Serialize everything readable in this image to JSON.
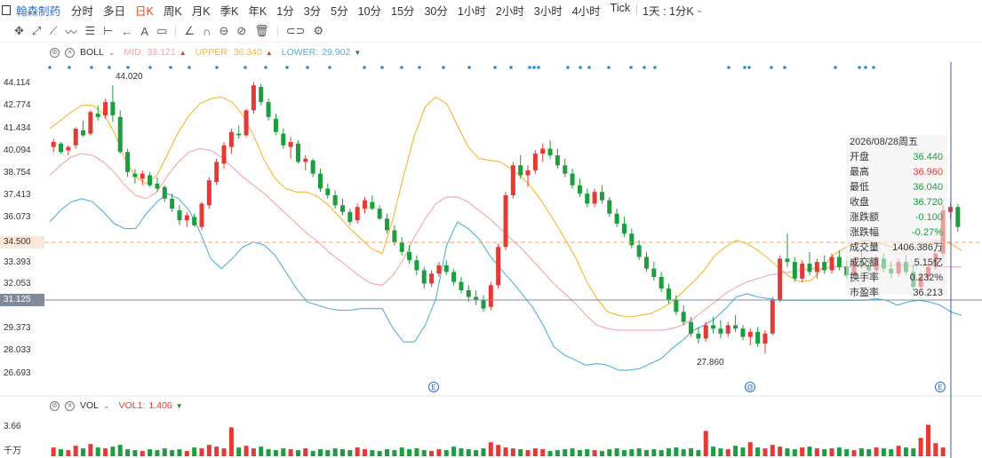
{
  "header": {
    "stock_name": "翰森制药",
    "periods": [
      "分时",
      "多日",
      "日K",
      "周K",
      "月K",
      "季K",
      "年K",
      "1分",
      "3分",
      "5分",
      "10分",
      "15分",
      "30分",
      "1小时",
      "2小时",
      "3小时",
      "4小时",
      "Tick"
    ],
    "active_period": "日K",
    "period_select": "1天 : 1分K"
  },
  "boll": {
    "name": "BOLL",
    "mid_label": "MID:",
    "mid": "33.121",
    "upper_label": "UPPER:",
    "upper": "36.340",
    "lower_label": "LOWER:",
    "lower": "29.902"
  },
  "vol": {
    "name": "VOL",
    "vol1_label": "VOL1:",
    "vol1": "1.406"
  },
  "y_axis": [
    "44.114",
    "42.774",
    "41.434",
    "40.094",
    "38.754",
    "37.413",
    "36.073",
    "33.393",
    "32.053",
    "29.373",
    "28.033",
    "26.693"
  ],
  "price_tags": {
    "last": "34.500",
    "cross": "31.125"
  },
  "annotations": {
    "high": "44.020",
    "low": "27.860"
  },
  "vol_axis": {
    "top": "3.66",
    "unit": "千万"
  },
  "event_markers": [
    "E",
    "@",
    "E"
  ],
  "tooltip": [
    {
      "label": "2026/08/28周五",
      "value": "",
      "color": ""
    },
    {
      "label": "开盘",
      "value": "36.440",
      "color": "green"
    },
    {
      "label": "最高",
      "value": "36.960",
      "color": "red"
    },
    {
      "label": "最低",
      "value": "36.040",
      "color": "green"
    },
    {
      "label": "收盘",
      "value": "36.720",
      "color": "green"
    },
    {
      "label": "涨跌额",
      "value": "-0.100",
      "color": "green"
    },
    {
      "label": "涨跌幅",
      "value": "-0.27%",
      "color": "green"
    },
    {
      "label": "成交量",
      "value": "1406.386万",
      "color": ""
    },
    {
      "label": "成交额",
      "value": "5.15亿",
      "color": ""
    },
    {
      "label": "换手率",
      "value": "0.232%",
      "color": ""
    },
    {
      "label": "市盈率",
      "value": "36.213",
      "color": ""
    }
  ],
  "colors": {
    "up": "#e53935",
    "down": "#1b9e3e",
    "upper": "#f5b82e",
    "mid": "#f4a6a8",
    "lower": "#4fb3d9",
    "accent": "#2a6ed6"
  },
  "chart_data": {
    "type": "candlestick",
    "ylim": [
      26.0,
      45.5
    ],
    "candles": [
      [
        40.3,
        40.8,
        40.0,
        40.6
      ],
      [
        40.5,
        40.6,
        39.9,
        40.0
      ],
      [
        40.1,
        40.4,
        39.8,
        40.3
      ],
      [
        40.4,
        41.5,
        40.2,
        41.4
      ],
      [
        41.3,
        41.9,
        40.9,
        41.0
      ],
      [
        41.1,
        42.5,
        41.0,
        42.4
      ],
      [
        42.3,
        42.8,
        41.9,
        42.1
      ],
      [
        42.2,
        43.2,
        42.0,
        43.0
      ],
      [
        43.0,
        44.0,
        41.8,
        42.2
      ],
      [
        42.1,
        42.5,
        39.9,
        40.0
      ],
      [
        40.0,
        40.2,
        38.5,
        38.8
      ],
      [
        38.7,
        39.0,
        38.1,
        38.5
      ],
      [
        38.4,
        38.9,
        38.0,
        38.7
      ],
      [
        38.6,
        38.8,
        37.9,
        38.0
      ],
      [
        38.1,
        38.5,
        37.6,
        37.8
      ],
      [
        37.9,
        38.0,
        37.0,
        37.2
      ],
      [
        37.2,
        37.5,
        36.4,
        36.6
      ],
      [
        36.5,
        36.8,
        35.6,
        35.9
      ],
      [
        35.9,
        36.4,
        35.5,
        36.2
      ],
      [
        36.1,
        36.3,
        35.5,
        35.6
      ],
      [
        35.5,
        37.0,
        35.3,
        36.9
      ],
      [
        36.8,
        38.5,
        36.6,
        38.3
      ],
      [
        38.2,
        39.6,
        38.0,
        39.4
      ],
      [
        39.3,
        40.6,
        39.0,
        40.4
      ],
      [
        40.3,
        41.4,
        39.9,
        41.2
      ],
      [
        41.1,
        41.6,
        40.8,
        41.0
      ],
      [
        41.0,
        42.6,
        40.9,
        42.5
      ],
      [
        42.5,
        44.2,
        42.3,
        44.0
      ],
      [
        43.9,
        44.1,
        42.8,
        43.0
      ],
      [
        43.0,
        43.2,
        41.9,
        42.1
      ],
      [
        42.0,
        42.3,
        41.0,
        41.2
      ],
      [
        41.1,
        41.4,
        40.2,
        40.4
      ],
      [
        40.3,
        40.9,
        39.6,
        40.6
      ],
      [
        40.5,
        40.7,
        39.3,
        39.4
      ],
      [
        39.4,
        39.8,
        38.9,
        39.6
      ],
      [
        39.5,
        39.6,
        38.5,
        38.7
      ],
      [
        38.7,
        39.0,
        37.6,
        37.8
      ],
      [
        37.8,
        38.1,
        37.2,
        37.4
      ],
      [
        37.4,
        37.7,
        36.6,
        36.8
      ],
      [
        36.8,
        37.2,
        36.2,
        36.4
      ],
      [
        36.4,
        36.6,
        35.6,
        35.8
      ],
      [
        35.9,
        36.9,
        35.7,
        36.7
      ],
      [
        36.6,
        37.3,
        36.3,
        37.1
      ],
      [
        37.0,
        37.4,
        36.5,
        36.6
      ],
      [
        36.6,
        36.8,
        35.9,
        36.0
      ],
      [
        36.0,
        36.3,
        35.1,
        35.3
      ],
      [
        35.3,
        35.6,
        34.4,
        34.6
      ],
      [
        34.6,
        34.9,
        33.8,
        34.0
      ],
      [
        34.0,
        34.4,
        33.3,
        33.5
      ],
      [
        33.5,
        33.8,
        32.6,
        32.9
      ],
      [
        32.9,
        33.1,
        31.8,
        32.1
      ],
      [
        32.1,
        32.9,
        31.9,
        32.7
      ],
      [
        32.7,
        33.4,
        32.5,
        33.2
      ],
      [
        33.2,
        33.5,
        32.6,
        32.8
      ],
      [
        32.8,
        33.0,
        32.0,
        32.2
      ],
      [
        32.2,
        32.5,
        31.5,
        31.7
      ],
      [
        31.7,
        32.0,
        31.0,
        31.3
      ],
      [
        31.3,
        31.7,
        30.8,
        31.1
      ],
      [
        31.1,
        31.4,
        30.4,
        30.6
      ],
      [
        30.7,
        32.2,
        30.5,
        32.0
      ],
      [
        32.0,
        34.5,
        31.8,
        34.3
      ],
      [
        34.3,
        37.6,
        34.1,
        37.4
      ],
      [
        37.4,
        39.4,
        37.2,
        39.2
      ],
      [
        39.2,
        39.8,
        38.4,
        38.6
      ],
      [
        38.6,
        39.2,
        37.9,
        38.9
      ],
      [
        38.9,
        40.1,
        38.7,
        39.9
      ],
      [
        39.9,
        40.5,
        39.4,
        40.2
      ],
      [
        40.2,
        40.7,
        39.6,
        39.8
      ],
      [
        39.8,
        40.2,
        39.0,
        39.2
      ],
      [
        39.2,
        39.6,
        38.5,
        38.7
      ],
      [
        38.7,
        39.0,
        37.8,
        38.0
      ],
      [
        38.0,
        38.4,
        37.3,
        37.5
      ],
      [
        37.5,
        37.8,
        36.7,
        36.9
      ],
      [
        36.9,
        37.8,
        36.7,
        37.6
      ],
      [
        37.6,
        38.0,
        36.9,
        37.1
      ],
      [
        37.1,
        37.3,
        36.1,
        36.3
      ],
      [
        36.3,
        36.6,
        35.5,
        35.7
      ],
      [
        35.7,
        36.1,
        34.9,
        35.1
      ],
      [
        35.1,
        35.4,
        34.2,
        34.4
      ],
      [
        34.4,
        34.7,
        33.5,
        33.7
      ],
      [
        33.7,
        34.0,
        32.8,
        33.0
      ],
      [
        33.0,
        33.4,
        32.3,
        32.5
      ],
      [
        32.5,
        32.8,
        31.6,
        31.8
      ],
      [
        31.8,
        32.1,
        30.9,
        31.1
      ],
      [
        31.1,
        31.4,
        30.2,
        30.4
      ],
      [
        30.4,
        30.8,
        29.6,
        29.8
      ],
      [
        29.8,
        30.1,
        28.9,
        29.1
      ],
      [
        29.1,
        29.5,
        28.5,
        28.8
      ],
      [
        28.8,
        29.8,
        28.6,
        29.6
      ],
      [
        29.6,
        30.1,
        29.1,
        29.4
      ],
      [
        29.4,
        29.9,
        28.8,
        29.1
      ],
      [
        29.1,
        29.8,
        28.9,
        29.6
      ],
      [
        29.6,
        30.2,
        29.2,
        29.4
      ],
      [
        29.4,
        29.6,
        28.7,
        28.9
      ],
      [
        28.9,
        29.4,
        28.4,
        29.2
      ],
      [
        29.2,
        29.5,
        28.3,
        28.5
      ],
      [
        28.5,
        29.3,
        27.9,
        29.1
      ],
      [
        29.1,
        31.3,
        29.0,
        31.1
      ],
      [
        31.1,
        33.8,
        31.0,
        33.6
      ],
      [
        33.6,
        35.1,
        33.1,
        33.4
      ],
      [
        33.4,
        33.7,
        32.2,
        32.4
      ],
      [
        32.4,
        33.5,
        32.2,
        33.3
      ],
      [
        33.3,
        34.0,
        32.6,
        32.8
      ],
      [
        32.8,
        33.6,
        32.4,
        33.4
      ],
      [
        33.4,
        33.8,
        32.7,
        32.9
      ],
      [
        32.9,
        33.9,
        32.7,
        33.7
      ],
      [
        33.7,
        34.1,
        32.9,
        33.1
      ],
      [
        33.1,
        33.5,
        32.4,
        32.6
      ],
      [
        32.6,
        33.7,
        32.5,
        33.5
      ],
      [
        33.5,
        34.2,
        33.0,
        33.2
      ],
      [
        33.2,
        33.6,
        32.6,
        32.9
      ],
      [
        32.9,
        33.8,
        32.7,
        33.6
      ],
      [
        33.6,
        33.9,
        32.8,
        33.0
      ],
      [
        33.0,
        33.4,
        32.4,
        32.7
      ],
      [
        32.7,
        33.6,
        32.5,
        33.4
      ],
      [
        33.4,
        33.8,
        32.6,
        32.8
      ],
      [
        32.8,
        33.2,
        31.7,
        31.9
      ],
      [
        31.9,
        32.7,
        31.7,
        32.5
      ],
      [
        32.5,
        33.3,
        32.3,
        33.1
      ],
      [
        33.1,
        34.1,
        32.9,
        33.9
      ],
      [
        33.9,
        36.8,
        33.7,
        36.5
      ],
      [
        36.4,
        36.9,
        36.0,
        36.7
      ],
      [
        36.7,
        36.9,
        35.2,
        35.5
      ]
    ],
    "volumes": [
      1.0,
      0.8,
      0.7,
      1.2,
      0.9,
      1.4,
      1.0,
      0.9,
      1.1,
      1.3,
      0.8,
      0.7,
      0.6,
      0.8,
      0.7,
      0.9,
      0.7,
      0.8,
      0.6,
      1.0,
      0.9,
      1.3,
      1.1,
      0.9,
      3.3,
      1.0,
      1.2,
      0.9,
      1.1,
      0.8,
      0.7,
      0.9,
      0.8,
      0.7,
      0.9,
      0.6,
      0.8,
      0.7,
      0.9,
      0.8,
      0.7,
      1.0,
      0.8,
      0.7,
      0.6,
      0.8,
      0.7,
      1.0,
      0.8,
      0.9,
      0.7,
      0.6,
      0.8,
      0.7,
      1.1,
      0.9,
      0.8,
      0.7,
      0.9,
      1.6,
      1.3,
      1.0,
      0.9,
      0.8,
      0.7,
      0.9,
      0.8,
      0.6,
      0.7,
      0.8,
      0.9,
      0.7,
      0.8,
      0.7,
      0.6,
      0.8,
      0.9,
      0.7,
      0.8,
      0.9,
      0.7,
      0.8,
      0.7,
      0.9,
      1.0,
      0.8,
      0.9,
      0.7,
      2.9,
      1.1,
      0.9,
      0.8,
      1.2,
      1.0,
      1.6,
      1.0,
      0.9,
      1.3,
      1.1,
      0.9,
      0.8,
      1.0,
      1.1,
      0.9,
      0.8,
      0.9,
      1.0,
      0.8,
      0.7,
      0.9,
      0.8,
      1.0,
      0.9,
      0.8,
      1.2,
      1.0,
      0.9,
      2.1,
      3.6,
      1.5,
      1.0
    ],
    "upper": [
      41.4,
      41.9,
      42.4,
      42.8,
      42.8,
      42.3,
      41.2,
      39.6,
      38.5,
      38.1,
      38.6,
      39.9,
      41.2,
      42.2,
      42.9,
      43.2,
      43.3,
      43.0,
      42.2,
      41.0,
      39.5,
      38.4,
      37.8,
      37.6,
      37.6,
      37.3,
      36.8,
      36.1,
      35.4,
      34.8,
      34.2,
      33.9,
      36.0,
      38.6,
      41.0,
      42.7,
      43.3,
      42.9,
      41.6,
      40.3,
      39.6,
      39.5,
      39.4,
      39.0,
      38.5,
      37.8,
      36.9,
      35.9,
      34.8,
      33.7,
      32.3,
      31.2,
      30.4,
      30.2,
      30.1,
      30.2,
      30.3,
      30.6,
      31.0,
      31.6,
      32.2,
      32.9,
      33.8,
      34.3,
      34.7,
      34.5,
      34.1,
      33.6,
      33.0,
      32.5,
      32.2,
      32.3,
      33.0,
      33.8,
      34.2,
      34.5,
      34.7,
      34.6,
      34.4,
      34.2,
      34.2,
      34.3,
      34.6,
      34.7,
      34.5,
      34.1
    ],
    "mid": [
      38.6,
      39.2,
      39.7,
      39.9,
      39.8,
      39.4,
      38.8,
      38.0,
      37.4,
      37.2,
      37.6,
      38.6,
      39.4,
      40.0,
      40.2,
      40.1,
      39.7,
      39.1,
      38.5,
      38.0,
      37.5,
      36.9,
      36.3,
      35.7,
      35.1,
      34.6,
      34.0,
      33.5,
      33.0,
      32.5,
      32.1,
      32.0,
      32.6,
      33.6,
      34.9,
      36.0,
      36.9,
      37.3,
      37.3,
      37.0,
      36.5,
      36.0,
      35.4,
      34.8,
      34.2,
      33.5,
      32.8,
      32.1,
      31.5,
      30.9,
      30.2,
      29.6,
      29.4,
      29.3,
      29.3,
      29.3,
      29.3,
      29.3,
      29.4,
      29.6,
      30.0,
      30.5,
      31.0,
      31.5,
      31.9,
      32.2,
      32.4,
      32.6,
      32.7,
      32.8,
      32.9,
      33.0,
      33.0,
      33.1,
      33.1,
      33.1,
      33.1,
      33.2,
      33.2,
      33.2,
      33.2,
      33.2,
      33.2,
      33.1,
      33.1,
      33.1
    ],
    "lower": [
      35.8,
      36.5,
      37.0,
      37.2,
      37.0,
      36.4,
      35.7,
      35.4,
      35.4,
      36.3,
      37.0,
      37.5,
      37.2,
      36.5,
      35.2,
      33.6,
      33.0,
      33.6,
      34.3,
      34.6,
      34.4,
      33.8,
      32.8,
      31.8,
      31.0,
      30.8,
      30.6,
      30.5,
      30.5,
      30.6,
      30.6,
      30.6,
      29.4,
      28.6,
      28.6,
      29.6,
      31.2,
      34.4,
      35.8,
      35.4,
      34.8,
      33.8,
      33.0,
      32.3,
      31.5,
      30.7,
      29.6,
      28.3,
      27.8,
      27.5,
      27.2,
      27.3,
      27.2,
      26.9,
      26.9,
      27.0,
      27.3,
      27.6,
      28.2,
      28.7,
      29.3,
      29.6,
      30.0,
      30.6,
      31.3,
      31.5,
      31.3,
      31.2,
      31.1,
      31.1,
      31.1,
      31.1,
      31.1,
      31.1,
      31.1,
      31.1,
      31.1,
      31.2,
      31.1,
      30.8,
      31.0,
      31.1,
      31.0,
      30.8,
      30.4,
      30.2
    ]
  }
}
